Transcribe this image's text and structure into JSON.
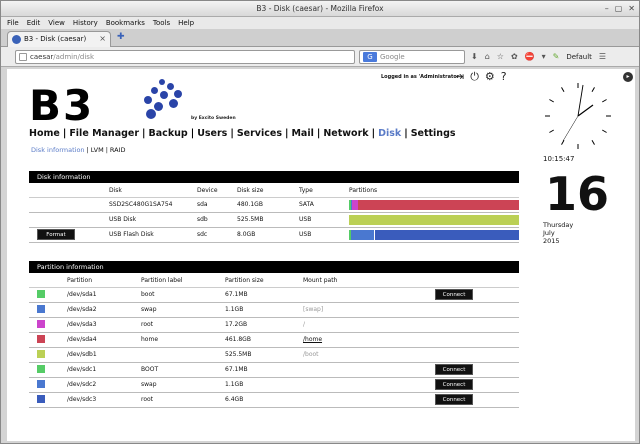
{
  "window": {
    "title": "B3 - Disk (caesar) - Mozilla Firefox"
  },
  "menu": [
    "File",
    "Edit",
    "View",
    "History",
    "Bookmarks",
    "Tools",
    "Help"
  ],
  "tab": {
    "label": "B3 - Disk (caesar)",
    "close": "×",
    "new": "✚"
  },
  "url": {
    "host": "caesar",
    "path": "/admin/disk"
  },
  "search": {
    "engine": "G",
    "placeholder": "Google",
    "default_label": "Default"
  },
  "header": {
    "logo": "B3",
    "byline": "by Excito Sweden",
    "logged_in": "Logged in as 'Administrator'"
  },
  "nav": {
    "items": [
      "Home",
      "File Manager",
      "Backup",
      "Users",
      "Services",
      "Mail",
      "Network",
      "Disk",
      "Settings"
    ],
    "active": "Disk"
  },
  "subnav": {
    "items": [
      "Disk information",
      "LVM",
      "RAID"
    ],
    "active": "Disk information"
  },
  "disk_info": {
    "title": "Disk information",
    "headers": [
      "Disk",
      "Device",
      "Disk size",
      "Type",
      "Partitions"
    ],
    "rows": [
      {
        "disk": "SSD2SC480G1SA754",
        "device": "sda",
        "size": "480.1GB",
        "type": "SATA",
        "button": ""
      },
      {
        "disk": "USB Disk",
        "device": "sdb",
        "size": "525.5MB",
        "type": "USB",
        "button": ""
      },
      {
        "disk": "USB Flash Disk",
        "device": "sdc",
        "size": "8.0GB",
        "type": "USB",
        "button": "Format"
      }
    ]
  },
  "partition_info": {
    "title": "Partition information",
    "headers": [
      "Partition",
      "Partition label",
      "Partition size",
      "Mount path"
    ],
    "rows": [
      {
        "color": "#55cc66",
        "partition": "/dev/sda1",
        "label": "boot",
        "size": "67.1MB",
        "mount": "",
        "button": "Connect"
      },
      {
        "color": "#4a78d0",
        "partition": "/dev/sda2",
        "label": "swap",
        "size": "1.1GB",
        "mount": "[swap]",
        "button": ""
      },
      {
        "color": "#cc44cc",
        "partition": "/dev/sda3",
        "label": "root",
        "size": "17.2GB",
        "mount": "/",
        "button": ""
      },
      {
        "color": "#cc4455",
        "partition": "/dev/sda4",
        "label": "home",
        "size": "461.8GB",
        "mount": "/home",
        "button": ""
      },
      {
        "color": "#bbd055",
        "partition": "/dev/sdb1",
        "label": "",
        "size": "525.5MB",
        "mount": "/boot",
        "button": ""
      },
      {
        "color": "#55cc66",
        "partition": "/dev/sdc1",
        "label": "BOOT",
        "size": "67.1MB",
        "mount": "",
        "button": "Connect"
      },
      {
        "color": "#4a78d0",
        "partition": "/dev/sdc2",
        "label": "swap",
        "size": "1.1GB",
        "mount": "",
        "button": "Connect"
      },
      {
        "color": "#3a5cbc",
        "partition": "/dev/sdc3",
        "label": "root",
        "size": "6.4GB",
        "mount": "",
        "button": "Connect"
      }
    ]
  },
  "partition_bars": [
    [
      {
        "color": "#55cc66",
        "frac": 0.01
      },
      {
        "color": "#4a78d0",
        "frac": 0.01
      },
      {
        "color": "#cc44cc",
        "frac": 0.035
      },
      {
        "color": "#cc4455",
        "frac": 0.945
      }
    ],
    [
      {
        "color": "#bbd055",
        "frac": 1.0
      }
    ],
    [
      {
        "color": "#55cc66",
        "frac": 0.01
      },
      {
        "color": "#4a78d0",
        "frac": 0.14
      },
      {
        "color": "#3a5cbc",
        "frac": 0.85
      }
    ]
  ],
  "clock": {
    "time": "10:15:47",
    "day": "16",
    "weekday": "Thursday",
    "month": "July",
    "year": "2015"
  }
}
